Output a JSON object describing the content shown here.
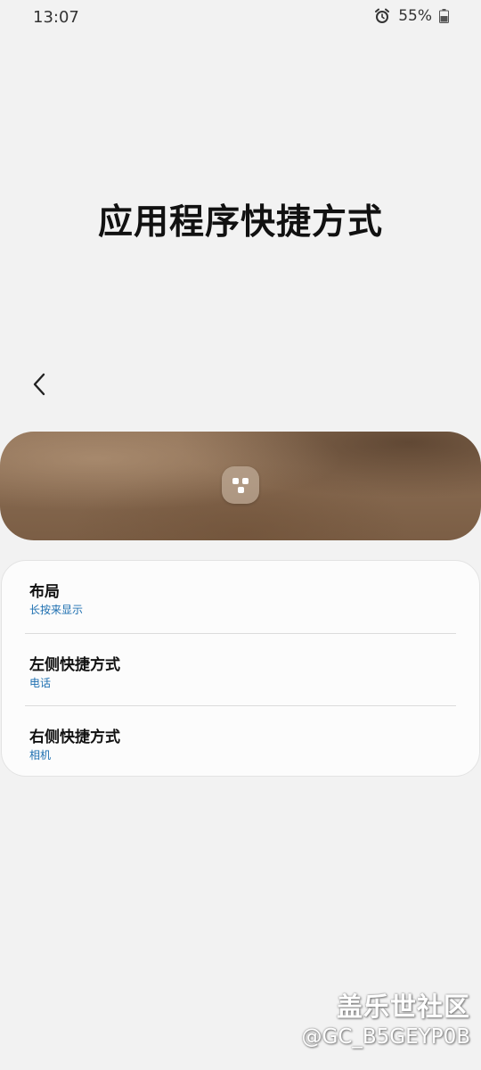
{
  "status_bar": {
    "time": "13:07",
    "battery": "55%",
    "icons": [
      "alarm-icon",
      "battery-icon"
    ]
  },
  "header": {
    "title": "应用程序快捷方式"
  },
  "nav": {
    "back_icon": "chevron-left-icon"
  },
  "preview": {
    "center_icon": "app-shortcut-icon"
  },
  "settings": {
    "items": [
      {
        "title": "布局",
        "value": "长按来显示"
      },
      {
        "title": "左侧快捷方式",
        "value": "电话"
      },
      {
        "title": "右侧快捷方式",
        "value": "相机"
      }
    ]
  },
  "watermark": {
    "line1": "盖乐世社区",
    "line2": "@GC_B5GEYP0B"
  },
  "colors": {
    "background": "#f2f2f2",
    "card": "#fcfcfc",
    "accent_subtitle": "#1d6fb0"
  }
}
